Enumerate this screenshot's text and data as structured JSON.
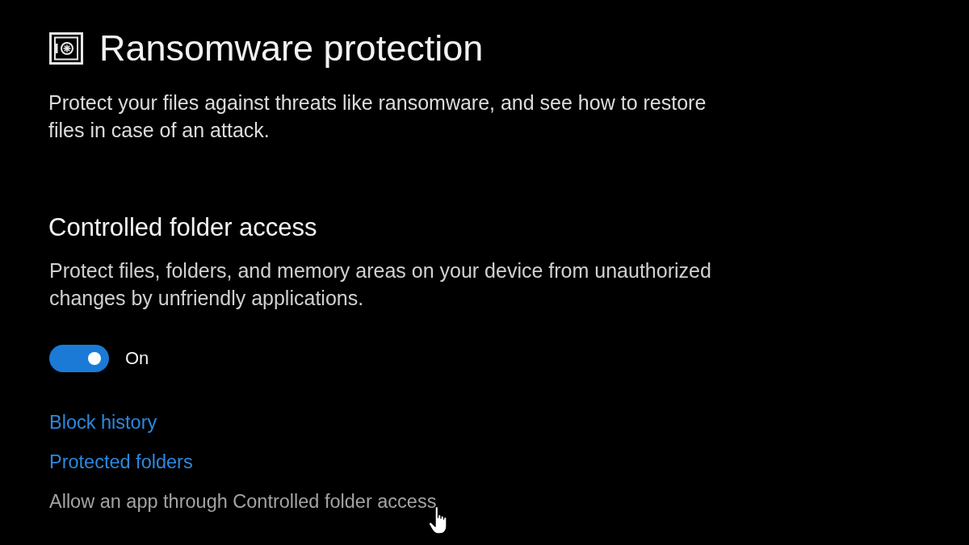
{
  "header": {
    "title": "Ransomware protection",
    "description": "Protect your files against threats like ransomware, and see how to restore files in case of an attack."
  },
  "controlled_folder_access": {
    "heading": "Controlled folder access",
    "description": "Protect files, folders, and memory areas on your device from unauthorized changes by unfriendly applications.",
    "toggle": {
      "on": true,
      "label": "On"
    },
    "links": [
      {
        "label": "Block history",
        "hovered": false
      },
      {
        "label": "Protected folders",
        "hovered": false
      },
      {
        "label": "Allow an app through Controlled folder access",
        "hovered": true
      }
    ]
  }
}
